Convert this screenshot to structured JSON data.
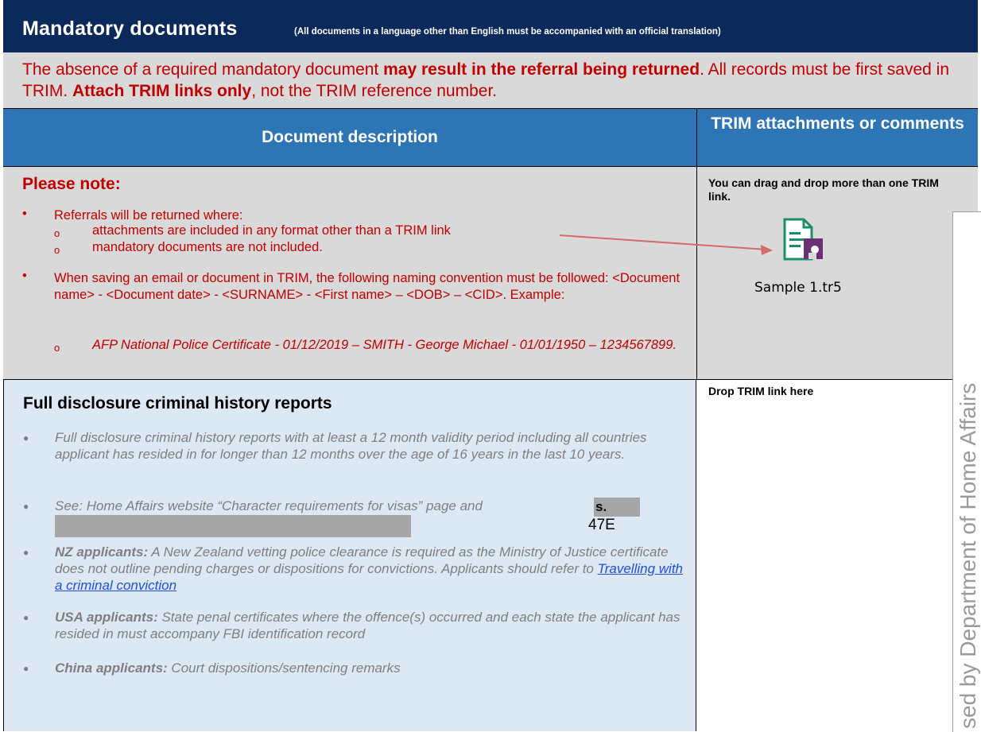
{
  "title": {
    "main": "Mandatory documents",
    "sub": "(All documents in a language other than English must be accompanied with an official translation)"
  },
  "warning": {
    "p1": "The absence of a required mandatory document ",
    "b1": "may result in the referral being returned",
    "p2": ". All records must be first saved in TRIM. ",
    "b2": "Attach TRIM links only",
    "p3": ", not the TRIM reference number."
  },
  "table_header": {
    "col1": "Document description",
    "col2": "TRIM attachments  or comments"
  },
  "please_note": {
    "title": "Please note:",
    "b1": "Referrals will be returned where:",
    "b1_sub1": "attachments are included in any format other than a TRIM link",
    "b1_sub2": "mandatory documents are not included.",
    "b2": "When saving an email or document in TRIM, the following naming convention must be followed: <Document name> - <Document date> - <SURNAME> - <First name> – <DOB> – <CID>. Example:",
    "b2_sub1": "AFP National Police Certificate - 01/12/2019 – SMITH - George Michael - 01/01/1950 – 1234567899."
  },
  "trim_panel": {
    "drag_text": "You can drag and drop more than one TRIM link.",
    "file_label": "Sample 1.tr5",
    "icon": "trim-record-icon"
  },
  "criminal": {
    "title": "Full disclosure criminal history reports",
    "i1": "Full disclosure criminal history reports with at least a 12 month validity period including all countries applicant has resided in for longer than 12 months over the age of 16 years in the last 10 years.",
    "i2": "See: Home Affairs website “Character requirements for visas” page and",
    "redaction_s": "s.",
    "redaction_code": "47E",
    "i3_bold": "NZ applicants:",
    "i3": " A New Zealand vetting police clearance is required as the Ministry of Justice certificate does not outline pending charges or dispositions for convictions. Applicants should refer to ",
    "i3_link": "Travelling with a criminal conviction",
    "i4_bold": "USA applicants:",
    "i4": " State penal certificates where the offence(s) occurred and each state the applicant has resided in must accompany FBI identification record",
    "i5_bold": "China applicants:",
    "i5": " Court dispositions/sentencing remarks",
    "drop_text": "Drop TRIM link here"
  },
  "watermark": "sed by Department of Home Affairs",
  "colors": {
    "title_bg": "#0b2a5b",
    "header_bg": "#2e75b6",
    "warning_red": "#c00000",
    "grey_band": "#d9d9d9",
    "light_blue": "#dde8f5"
  }
}
